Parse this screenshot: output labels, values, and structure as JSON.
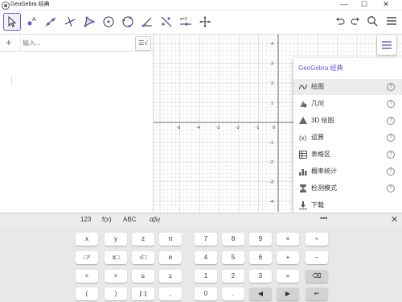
{
  "window": {
    "title": "GeoGebra 经典",
    "controls": [
      "—",
      "☐",
      "✕"
    ]
  },
  "toolbar": {
    "tools": [
      {
        "name": "move-tool",
        "icon": "pointer-icon",
        "active": true
      },
      {
        "name": "point-tool",
        "icon": "point-icon"
      },
      {
        "name": "line-tool",
        "icon": "line-icon"
      },
      {
        "name": "perpendicular-tool",
        "icon": "perpendicular-icon"
      },
      {
        "name": "polygon-tool",
        "icon": "polygon-icon"
      },
      {
        "name": "circle-tool",
        "icon": "circle-icon"
      },
      {
        "name": "circle-three-points-tool",
        "icon": "circle-three-points-icon"
      },
      {
        "name": "angle-tool",
        "icon": "angle-icon"
      },
      {
        "name": "reflect-tool",
        "icon": "reflect-icon"
      },
      {
        "name": "slider-tool",
        "icon": "slider-icon",
        "label": "a=2"
      },
      {
        "name": "move-view-tool",
        "icon": "move-view-icon"
      }
    ],
    "right": [
      "undo-icon",
      "redo-icon",
      "search-icon",
      "hamburger-menu-icon"
    ]
  },
  "algebra": {
    "input_placeholder": "输入..."
  },
  "graphics": {
    "x_ticks": [
      "-5",
      "-4",
      "-3",
      "-2",
      "-1",
      "0"
    ],
    "y_ticks": [
      "4",
      "3",
      "2",
      "1",
      "-1",
      "-2",
      "-3",
      "-4"
    ]
  },
  "menu": {
    "title": "GeoGebra 经典",
    "items": [
      {
        "label": "绘图",
        "icon": "graph-icon",
        "selected": true
      },
      {
        "label": "几何",
        "icon": "geometry-icon"
      },
      {
        "label": "3D 绘图",
        "icon": "3d-graph-icon"
      },
      {
        "label": "运算",
        "icon": "cas-icon"
      },
      {
        "label": "表格区",
        "icon": "spreadsheet-icon"
      },
      {
        "label": "概率统计",
        "icon": "probability-icon"
      },
      {
        "label": "检测模式",
        "icon": "exam-icon"
      },
      {
        "label": "下载",
        "icon": "download-icon"
      }
    ],
    "help_label": "?"
  },
  "keyboard": {
    "tabs": [
      "123",
      "f(x)",
      "ABC",
      "αβγ"
    ],
    "more": "•••",
    "close": "✕",
    "rows": [
      [
        "x",
        "y",
        "z",
        "π",
        "7",
        "8",
        "9",
        "×",
        "÷"
      ],
      [
        "□²",
        "x□",
        "√□",
        "e",
        "4",
        "5",
        "6",
        "+",
        "−"
      ],
      [
        "<",
        ">",
        "≤",
        "≥",
        "1",
        "2",
        "3",
        "=",
        "⌫"
      ],
      [
        "(",
        ")",
        "|□|",
        ",",
        "0",
        ".",
        "◀",
        "▶",
        "↵"
      ]
    ],
    "colors": {
      "accent": "#6557d2",
      "key": "#ffffff",
      "key_dark": "#d3d3d3",
      "background": "#e8e8e8"
    }
  }
}
